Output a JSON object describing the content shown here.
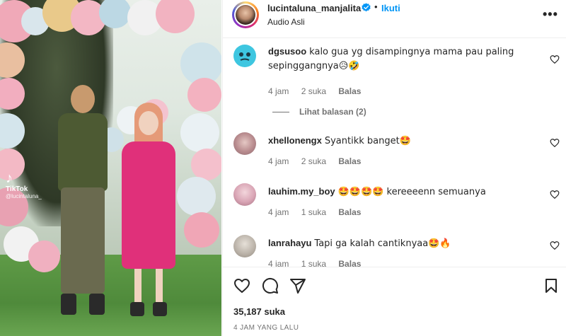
{
  "media": {
    "watermark_logo": "♪",
    "watermark_brand": "TikTok",
    "watermark_user": "@lucintaluna_",
    "colors": {
      "dress": "#e0307a",
      "outfit": "#4d5a33",
      "grass": "#5f9b47"
    }
  },
  "header": {
    "username": "lucintaluna_manjalita",
    "follow_label": "Ikuti",
    "separator": "•",
    "subtitle": "Audio Asli",
    "more_label": "•••"
  },
  "comments": [
    {
      "user": "dgsusoo",
      "text": "kalo gua yg disampingnya mama pau paling sepinggangnya😥🤣",
      "time": "4 jam",
      "likes": "2 suka",
      "reply": "Balas",
      "avatar_color": "#3ec6e0"
    },
    {
      "user": "xhellonengx",
      "text": "Syantikk banget🤩",
      "time": "4 jam",
      "likes": "2 suka",
      "reply": "Balas",
      "avatar_color": "#c9a3a6"
    },
    {
      "user": "lauhim.my_boy",
      "text": "🤩🤩🤩🤩 kereeeenn semuanya",
      "time": "4 jam",
      "likes": "1 suka",
      "reply": "Balas",
      "avatar_color": "#d9a5b5"
    },
    {
      "user": "lanrahayu",
      "text": "Tapi ga kalah cantiknyaa🤩🔥",
      "time": "4 jam",
      "likes": "1 suka",
      "reply": "Balas",
      "avatar_color": "#b8b0a6"
    }
  ],
  "view_replies": "Lihat balasan (2)",
  "actions": {
    "likes": "35,187 suka",
    "time": "4 JAM YANG LALU",
    "icons": [
      "heart-icon",
      "comment-icon",
      "share-icon",
      "bookmark-icon"
    ]
  },
  "colors": {
    "accent": "#0095f6",
    "text": "#262626",
    "muted": "#737373",
    "border": "#efefef"
  }
}
